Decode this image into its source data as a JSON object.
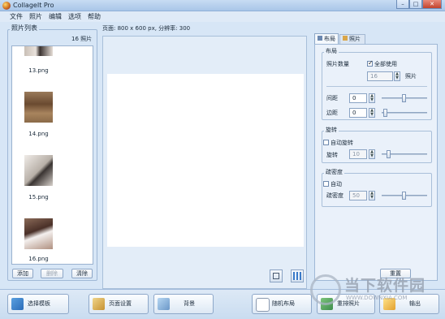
{
  "window": {
    "title": "CollageIt Pro",
    "minimize": "–",
    "maximize": "□",
    "close": "✕"
  },
  "menu": [
    "文件",
    "照片",
    "编辑",
    "选项",
    "帮助"
  ],
  "photo_list": {
    "label": "照片列表",
    "count": "16 照片",
    "items": [
      "13.png",
      "14.png",
      "15.png",
      "16.png"
    ],
    "add": "添加",
    "delete": "删除",
    "clear": "清除"
  },
  "page_info": "页面: 800 x 600 px, 分辨率: 300",
  "tabs": {
    "layout": "布局",
    "photo": "照片"
  },
  "layout_group": {
    "label": "布局",
    "photo_count_label": "照片数量",
    "use_all_label": "全部使用",
    "use_all_checked": true,
    "count_value": "16",
    "count_unit": "照片",
    "spacing_label": "间距",
    "spacing_value": "0",
    "margin_label": "边距",
    "margin_value": "0"
  },
  "rotation_group": {
    "label": "旋转",
    "auto_label": "自动旋转",
    "auto_checked": false,
    "rotate_label": "旋转",
    "rotate_value": "10"
  },
  "density_group": {
    "label": "疏密度",
    "auto_label": "自动",
    "auto_checked": false,
    "density_label": "疏密度",
    "density_value": "50"
  },
  "reset": "重置",
  "toolbar": {
    "choose_template": "选择模板",
    "page_setup": "页面设置",
    "background": "背景",
    "random_layout": "随机布局",
    "reorder_photos": "重排照片",
    "export": "输出"
  },
  "watermark": {
    "text": "当下软件园",
    "url": "WWW.DOWNXIA.COM"
  }
}
